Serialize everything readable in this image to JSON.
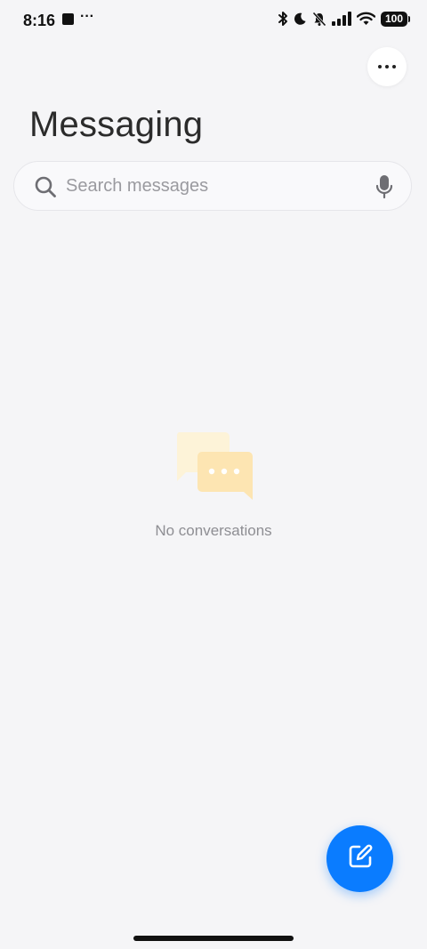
{
  "status_bar": {
    "time": "8:16",
    "more_indicator": "···",
    "battery": "100",
    "icons": [
      "bluetooth-icon",
      "moon-icon",
      "bell-off-icon",
      "signal-icon",
      "wifi-icon",
      "battery-icon"
    ]
  },
  "header": {
    "title": "Messaging",
    "more_icon": "more-horizontal-icon"
  },
  "search": {
    "placeholder": "Search messages",
    "value": "",
    "left_icon": "search-icon",
    "right_icon": "microphone-icon"
  },
  "empty_state": {
    "icon": "chat-bubbles-icon",
    "text": "No conversations"
  },
  "fab": {
    "icon": "compose-icon",
    "color": "#0a7cff"
  },
  "colors": {
    "background": "#f5f5f7",
    "accent": "#0a7cff",
    "muted_text": "#8e8e93",
    "illustration": "#fde9b8"
  }
}
